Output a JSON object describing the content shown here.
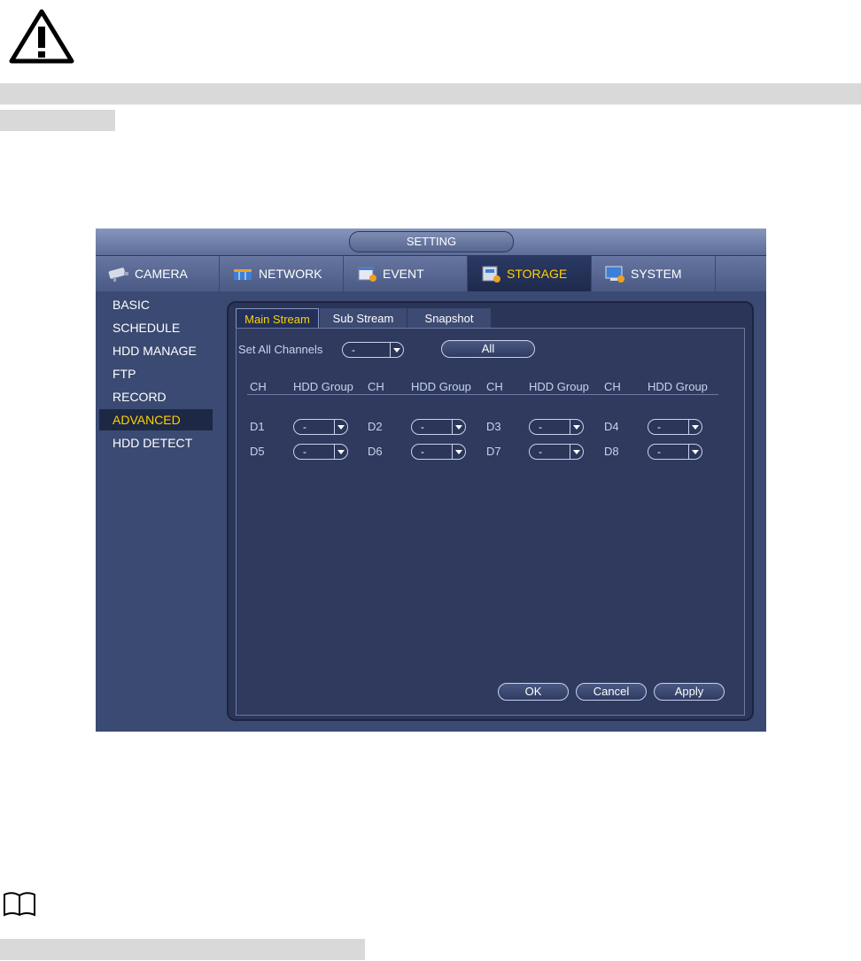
{
  "window": {
    "title": "SETTING"
  },
  "main_tabs": [
    {
      "label": "CAMERA",
      "icon": "camera-icon"
    },
    {
      "label": "NETWORK",
      "icon": "network-icon"
    },
    {
      "label": "EVENT",
      "icon": "event-icon"
    },
    {
      "label": "STORAGE",
      "icon": "storage-icon",
      "active": true
    },
    {
      "label": "SYSTEM",
      "icon": "system-icon"
    }
  ],
  "sidebar": {
    "items": [
      "BASIC",
      "SCHEDULE",
      "HDD MANAGE",
      "FTP",
      "RECORD",
      "ADVANCED",
      "HDD DETECT"
    ],
    "active": "ADVANCED"
  },
  "sub_tabs": [
    {
      "label": "Main Stream",
      "active": true
    },
    {
      "label": "Sub Stream"
    },
    {
      "label": "Snapshot"
    }
  ],
  "set_all": {
    "label": "Set All Channels",
    "value": "-",
    "all_button": "All"
  },
  "table": {
    "header_ch": "CH",
    "header_group": "HDD Group",
    "rows": [
      [
        {
          "ch": "D1",
          "group": "-"
        },
        {
          "ch": "D2",
          "group": "-"
        },
        {
          "ch": "D3",
          "group": "-"
        },
        {
          "ch": "D4",
          "group": "-"
        }
      ],
      [
        {
          "ch": "D5",
          "group": "-"
        },
        {
          "ch": "D6",
          "group": "-"
        },
        {
          "ch": "D7",
          "group": "-"
        },
        {
          "ch": "D8",
          "group": "-"
        }
      ]
    ]
  },
  "buttons": {
    "ok": "OK",
    "cancel": "Cancel",
    "apply": "Apply"
  },
  "colors": {
    "accent": "#ffd200",
    "panel": "#2f3a5e",
    "label": "#c8d2ee"
  }
}
